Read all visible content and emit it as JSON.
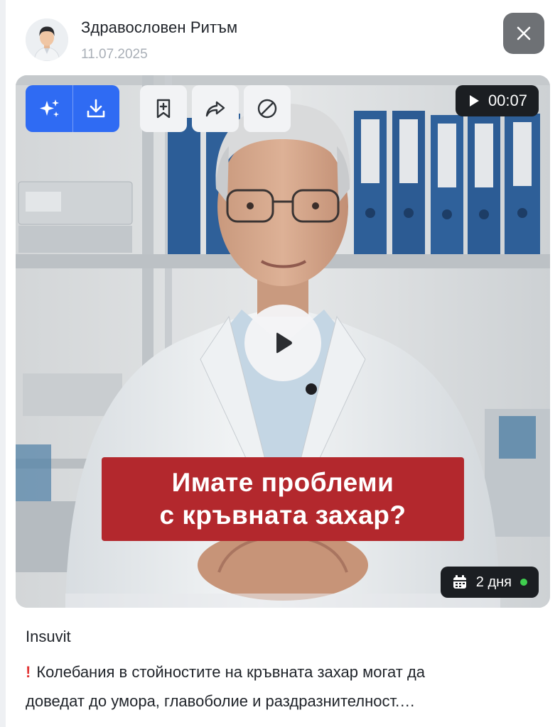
{
  "post": {
    "author": "Здравословен Ритъм",
    "date": "11.07.2025",
    "title": "Insuvit",
    "text_line1": "Колебания в стойностите на кръвната захар могат да",
    "text_line2": "доведат до умора, главоболие и раздразнителност.…",
    "warn_icon": "exclamation-mark-icon"
  },
  "video": {
    "duration": "00:07",
    "caption_line1": "Имате проблеми",
    "caption_line2": "с кръвната захар?",
    "age_label": "2 дня"
  },
  "toolbar": {
    "icons": [
      "sparkles-icon",
      "download-icon",
      "bookmark-add-icon",
      "share-icon",
      "block-icon"
    ]
  },
  "colors": {
    "accent_blue": "#2f6bf3",
    "caption_red": "#b3282d",
    "status_green": "#3fce4f",
    "close_button": "#6e7175"
  }
}
